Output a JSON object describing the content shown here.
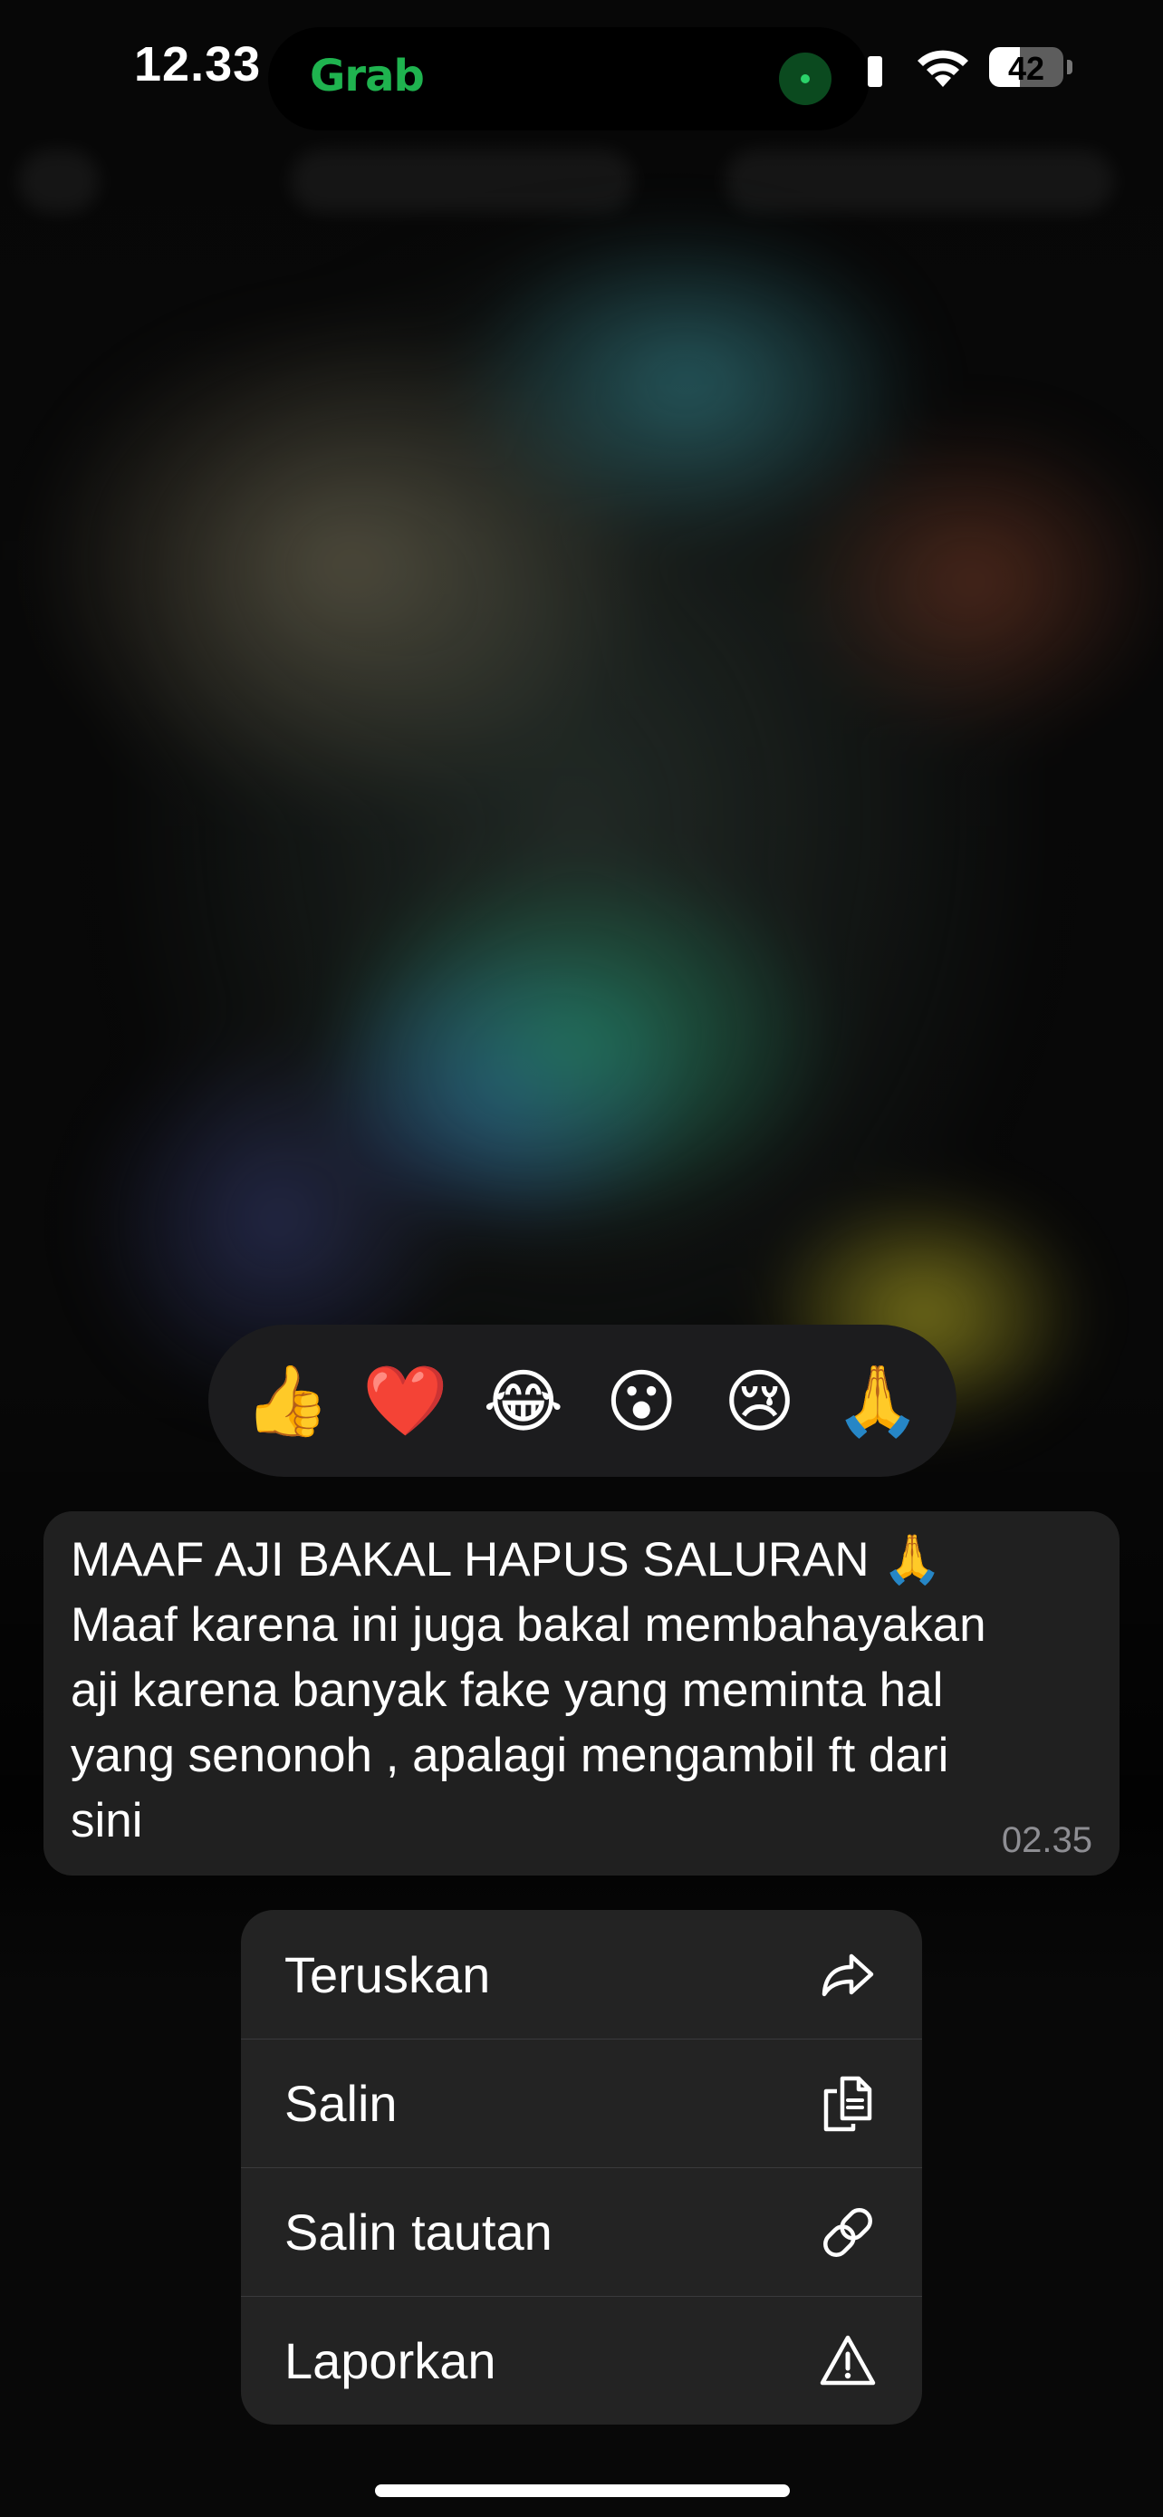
{
  "status_bar": {
    "time": "12.33",
    "live_activity_app": "Grab",
    "battery_level": "42",
    "battery_fraction": 0.42,
    "icons": [
      "cellular-signal-icon",
      "wifi-icon",
      "battery-icon"
    ]
  },
  "reactions": {
    "emojis": [
      "👍",
      "❤️",
      "😂",
      "😮",
      "😢",
      "🙏"
    ],
    "names": [
      "thumbs-up",
      "heart",
      "laughing",
      "surprised",
      "crying",
      "pray"
    ]
  },
  "message": {
    "lines": [
      "MAAF AJI BAKAL HAPUS SALURAN 🙏",
      "Maaf karena ini juga bakal membahayakan",
      "aji karena banyak fake yang meminta hal",
      "yang senonoh , apalagi mengambil ft dari",
      "sini"
    ],
    "time": "02.35"
  },
  "menu": {
    "items": [
      {
        "label": "Teruskan",
        "icon": "forward-arrow-icon"
      },
      {
        "label": "Salin",
        "icon": "copy-icon"
      },
      {
        "label": "Salin tautan",
        "icon": "link-icon"
      },
      {
        "label": "Laporkan",
        "icon": "warning-triangle-icon"
      }
    ]
  },
  "colors": {
    "brand_grab": "#1fb34f",
    "bubble_bg": "#202020",
    "menu_bg": "#232323",
    "timestamp": "#8e8e93"
  }
}
